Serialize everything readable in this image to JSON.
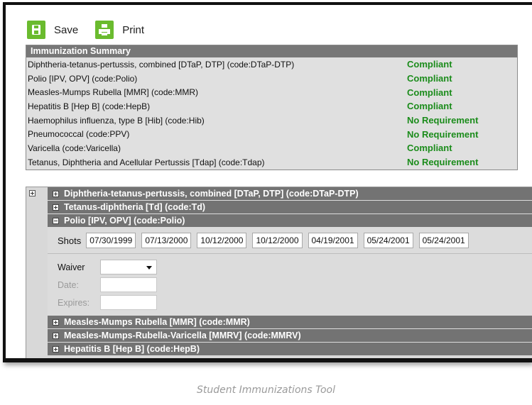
{
  "toolbar": {
    "save_label": "Save",
    "print_label": "Print"
  },
  "summary": {
    "title": "Immunization Summary",
    "rows": [
      {
        "name": "Diphtheria-tetanus-pertussis, combined [DTaP, DTP] (code:DTaP-DTP)",
        "status": "Compliant"
      },
      {
        "name": "Polio [IPV, OPV] (code:Polio)",
        "status": "Compliant"
      },
      {
        "name": "Measles-Mumps Rubella [MMR] (code:MMR)",
        "status": "Compliant"
      },
      {
        "name": "Hepatitis B [Hep B] (code:HepB)",
        "status": "Compliant"
      },
      {
        "name": "Haemophilus influenza, type B [Hib] (code:Hib)",
        "status": "No Requirement"
      },
      {
        "name": "Pneumococcal (code:PPV)",
        "status": "No Requirement"
      },
      {
        "name": "Varicella (code:Varicella)",
        "status": "Compliant"
      },
      {
        "name": "Tetanus, Diphtheria and Acellular Pertussis [Tdap] (code:Tdap)",
        "status": "No Requirement"
      }
    ]
  },
  "vaccines": {
    "dtap": "Diphtheria-tetanus-pertussis, combined [DTaP, DTP] (code:DTaP-DTP)",
    "td": "Tetanus-diphtheria [Td] (code:Td)",
    "polio": "Polio [IPV, OPV] (code:Polio)",
    "mmr": "Measles-Mumps Rubella [MMR] (code:MMR)",
    "mmrv": "Measles-Mumps-Rubella-Varicella [MMRV] (code:MMRV)",
    "hepb": "Hepatitis B [Hep B] (code:HepB)"
  },
  "polio": {
    "shots_label": "Shots",
    "shots": [
      "07/30/1999",
      "07/13/2000",
      "10/12/2000",
      "10/12/2000",
      "04/19/2001",
      "05/24/2001",
      "05/24/2001"
    ],
    "waiver_label": "Waiver",
    "waiver_value": "",
    "date_label": "Date:",
    "expires_label": "Expires:"
  },
  "caption": "Student Immunizations Tool",
  "colors": {
    "accent_green": "#6abb2e",
    "status_green": "#1b8c1b",
    "header_gray": "#737373"
  }
}
